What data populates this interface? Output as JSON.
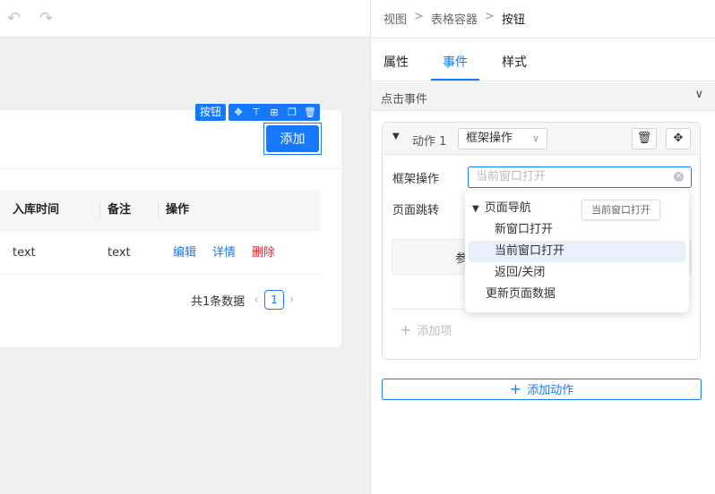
{
  "toolbar": {
    "undo_icon": "undo-icon",
    "redo_icon": "redo-icon"
  },
  "canvas": {
    "component_tag": "按钮",
    "component_tools": [
      "move-icon",
      "align-top-icon",
      "table-icon",
      "copy-icon",
      "delete-icon"
    ],
    "add_button": "添加",
    "table": {
      "columns": [
        "入库时间",
        "备注",
        "操作"
      ],
      "rows": [
        {
          "cells": [
            "text",
            "text"
          ],
          "actions": [
            "编辑",
            "详情",
            "删除"
          ]
        }
      ]
    },
    "pagination": {
      "total_text": "共1条数据",
      "current_page": "1"
    }
  },
  "panel": {
    "breadcrumb": [
      "视图",
      "表格容器",
      "按钮"
    ],
    "breadcrumb_sep": ">",
    "tabs": [
      "属性",
      "事件",
      "样式"
    ],
    "active_tab": "事件",
    "event_section": "点击事件",
    "action": {
      "name": "动作 1",
      "type_select": "框架操作",
      "form": {
        "frame_label": "框架操作",
        "frame_placeholder": "当前窗口打开",
        "jump_label": "页面跳转",
        "partial_text": "参"
      },
      "add_item": "添加项"
    },
    "add_action": "添加动作"
  },
  "dropdown": {
    "groups": [
      {
        "label": "页面导航",
        "children": [
          "新窗口打开",
          "当前窗口打开",
          "返回/关闭"
        ]
      },
      {
        "label": "更新页面数据",
        "children": []
      }
    ],
    "selected": "当前窗口打开",
    "tooltip": "当前窗口打开"
  },
  "colors": {
    "accent": "#1677ff",
    "danger": "#f5222d"
  }
}
